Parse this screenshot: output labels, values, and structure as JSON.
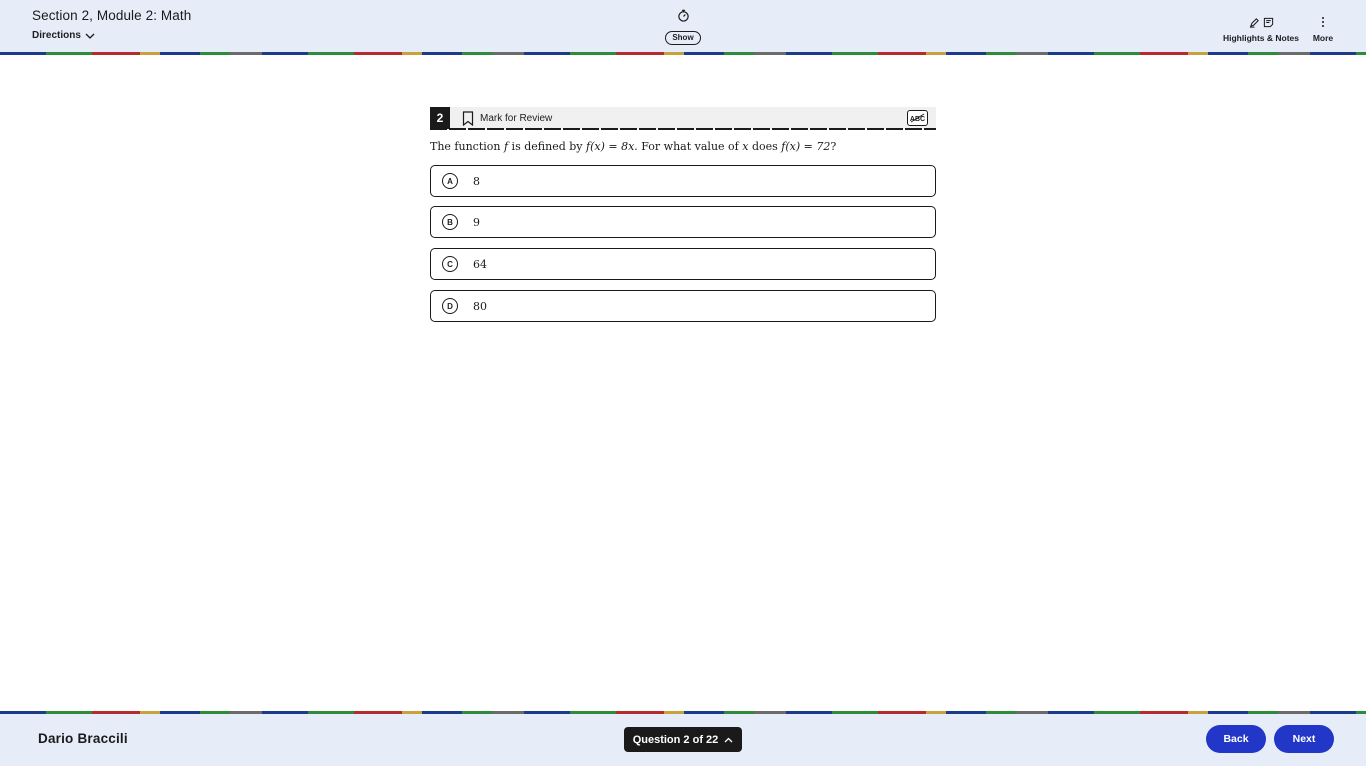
{
  "header": {
    "section_title": "Section 2, Module 2: Math",
    "directions_label": "Directions",
    "timer_toggle_label": "Show",
    "highlights_notes_label": "Highlights & Notes",
    "more_label": "More"
  },
  "question": {
    "number": "2",
    "mark_for_review_label": "Mark for Review",
    "text": {
      "p1": "The function ",
      "v1": "f",
      "p2": " is defined by ",
      "m1": "f(x) = 8x",
      "p3": ". For what value of ",
      "v2": "x",
      "p4": " does ",
      "m2": "f(x) = 72",
      "p5": "?"
    },
    "choices": [
      {
        "letter": "A",
        "value": "8"
      },
      {
        "letter": "B",
        "value": "9"
      },
      {
        "letter": "C",
        "value": "64"
      },
      {
        "letter": "D",
        "value": "80"
      }
    ]
  },
  "footer": {
    "student_name": "Dario Braccili",
    "question_nav_label": "Question 2 of 22",
    "back_label": "Back",
    "next_label": "Next"
  },
  "icons": {
    "timer": "stopwatch-icon",
    "directions_chevron": "chevron-down-icon",
    "highlighter": "highlighter-icon",
    "notes": "note-icon",
    "more": "vertical-dots-icon",
    "bookmark": "bookmark-icon",
    "strikethrough_abc": "abc-strikethrough-icon",
    "question_nav_chevron": "chevron-up-icon"
  },
  "colors": {
    "header_bg": "#e6edf8",
    "nav_button_blue": "#2237c8",
    "question_badge": "#1a1a1a"
  }
}
